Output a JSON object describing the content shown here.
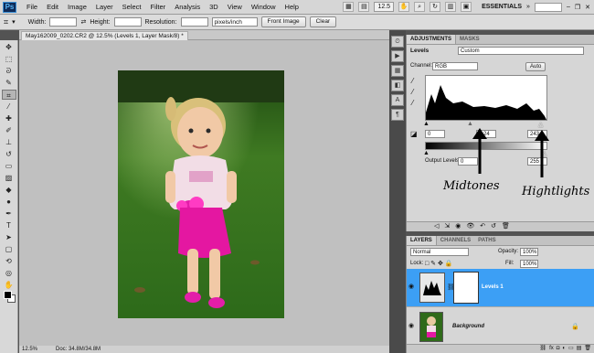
{
  "menubar": {
    "logo": "Ps",
    "items": [
      "File",
      "Edit",
      "Image",
      "Layer",
      "Select",
      "Filter",
      "Analysis",
      "3D",
      "View",
      "Window",
      "Help"
    ],
    "zoom": "12.5",
    "workspace": "ESSENTIALS"
  },
  "options": {
    "width_label": "Width:",
    "height_label": "Height:",
    "resolution_label": "Resolution:",
    "resolution_unit": "pixels/inch",
    "front_image": "Front Image",
    "clear": "Clear"
  },
  "document": {
    "tab_title": "May162009_0202.CR2 @ 12.5% (Levels 1, Layer Mask/8) *",
    "status_zoom": "12.5%",
    "status_doc": "Doc: 34.8M/34.8M"
  },
  "adjustments": {
    "tabs": [
      "ADJUSTMENTS",
      "MASKS"
    ],
    "levels_label": "Levels",
    "preset": "Custom",
    "channel_label": "Channel:",
    "channel": "RGB",
    "auto": "Auto",
    "input_black": "0",
    "input_mid": "1.24",
    "input_white": "243",
    "output_label": "Output Levels:",
    "output_black": "0",
    "output_white": "255"
  },
  "annotations": {
    "midtones": "Midtones",
    "highlights": "Hightlights"
  },
  "layers": {
    "tabs": [
      "LAYERS",
      "CHANNELS",
      "PATHS"
    ],
    "blend_mode": "Normal",
    "opacity_label": "Opacity:",
    "opacity": "100%",
    "lock_label": "Lock:",
    "fill_label": "Fill:",
    "fill": "100%",
    "items": [
      {
        "name": "Levels 1"
      },
      {
        "name": "Background"
      }
    ]
  }
}
